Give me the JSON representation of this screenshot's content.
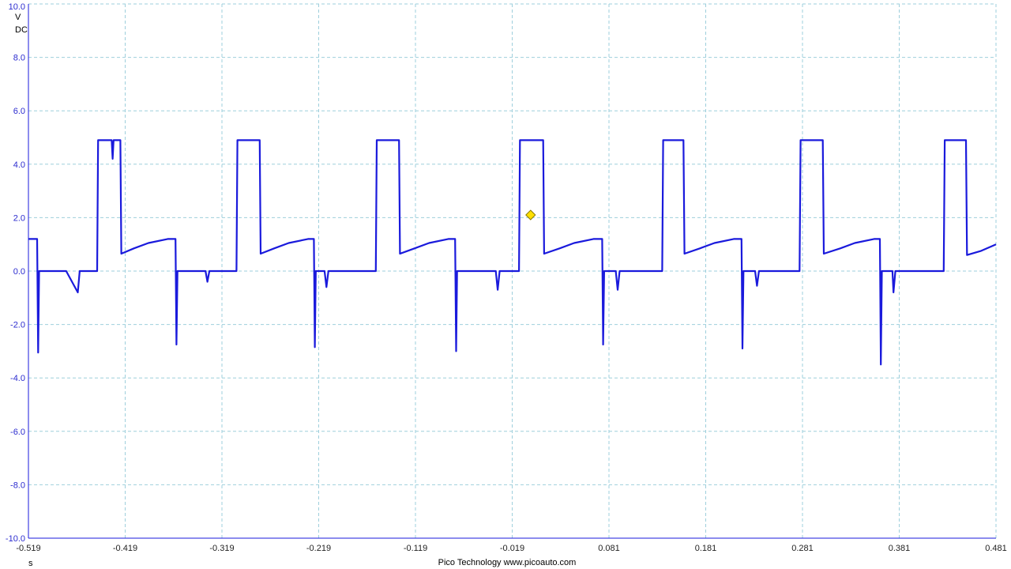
{
  "chart_data": {
    "type": "line",
    "title": "",
    "xlabel": "",
    "ylabel": "",
    "x_unit": "s",
    "y_unit": "V",
    "coupling": "DC",
    "xlim": [
      -0.519,
      0.481
    ],
    "ylim": [
      -10.0,
      10.0
    ],
    "grid": true,
    "grid_style": "dashed",
    "x_ticks": [
      "-0.519",
      "-0.419",
      "-0.319",
      "-0.219",
      "-0.119",
      "-0.019",
      "0.081",
      "0.181",
      "0.281",
      "0.381",
      "0.481"
    ],
    "y_ticks": [
      "10.0",
      "8.0",
      "6.0",
      "4.0",
      "2.0",
      "0.0",
      "-2.0",
      "-4.0",
      "-6.0",
      "-8.0",
      "-10.0"
    ],
    "colors": {
      "trace": "#1a1adc",
      "axis_text": "#2c2ccf",
      "grid": "#9ecfdc",
      "trigger": "#ffe000"
    },
    "trigger": {
      "x": 0.0,
      "y": 2.1
    },
    "series": [
      {
        "points": [
          [
            -0.519,
            1.2
          ],
          [
            -0.51,
            1.2
          ],
          [
            -0.509,
            -3.05
          ],
          [
            -0.508,
            0.0
          ],
          [
            -0.48,
            0.0
          ],
          [
            -0.468,
            -0.8
          ],
          [
            -0.466,
            0.0
          ],
          [
            -0.448,
            0.0
          ],
          [
            -0.447,
            4.9
          ],
          [
            -0.433,
            4.9
          ],
          [
            -0.432,
            4.2
          ],
          [
            -0.431,
            4.9
          ],
          [
            -0.424,
            4.9
          ],
          [
            -0.423,
            0.65
          ],
          [
            -0.41,
            0.85
          ],
          [
            -0.395,
            1.05
          ],
          [
            -0.375,
            1.2
          ],
          [
            -0.367,
            1.2
          ],
          [
            -0.366,
            -2.75
          ],
          [
            -0.365,
            0.0
          ],
          [
            -0.336,
            0.0
          ],
          [
            -0.334,
            -0.4
          ],
          [
            -0.332,
            0.0
          ],
          [
            -0.304,
            0.0
          ],
          [
            -0.303,
            4.9
          ],
          [
            -0.28,
            4.9
          ],
          [
            -0.279,
            0.65
          ],
          [
            -0.265,
            0.85
          ],
          [
            -0.25,
            1.05
          ],
          [
            -0.23,
            1.2
          ],
          [
            -0.224,
            1.2
          ],
          [
            -0.223,
            -2.85
          ],
          [
            -0.222,
            0.0
          ],
          [
            -0.213,
            0.0
          ],
          [
            -0.211,
            -0.6
          ],
          [
            -0.209,
            0.0
          ],
          [
            -0.16,
            0.0
          ],
          [
            -0.159,
            4.9
          ],
          [
            -0.136,
            4.9
          ],
          [
            -0.135,
            0.65
          ],
          [
            -0.12,
            0.85
          ],
          [
            -0.105,
            1.05
          ],
          [
            -0.085,
            1.2
          ],
          [
            -0.078,
            1.2
          ],
          [
            -0.077,
            -3.0
          ],
          [
            -0.076,
            0.0
          ],
          [
            -0.036,
            0.0
          ],
          [
            -0.034,
            -0.7
          ],
          [
            -0.032,
            0.0
          ],
          [
            -0.012,
            0.0
          ],
          [
            -0.011,
            4.9
          ],
          [
            0.013,
            4.9
          ],
          [
            0.014,
            0.65
          ],
          [
            0.03,
            0.85
          ],
          [
            0.045,
            1.05
          ],
          [
            0.065,
            1.2
          ],
          [
            0.074,
            1.2
          ],
          [
            0.075,
            -2.75
          ],
          [
            0.076,
            0.0
          ],
          [
            0.088,
            0.0
          ],
          [
            0.09,
            -0.7
          ],
          [
            0.092,
            0.0
          ],
          [
            0.136,
            0.0
          ],
          [
            0.137,
            4.9
          ],
          [
            0.158,
            4.9
          ],
          [
            0.159,
            0.65
          ],
          [
            0.175,
            0.85
          ],
          [
            0.19,
            1.05
          ],
          [
            0.21,
            1.2
          ],
          [
            0.218,
            1.2
          ],
          [
            0.219,
            -2.9
          ],
          [
            0.22,
            0.0
          ],
          [
            0.232,
            0.0
          ],
          [
            0.234,
            -0.55
          ],
          [
            0.236,
            0.0
          ],
          [
            0.278,
            0.0
          ],
          [
            0.279,
            4.9
          ],
          [
            0.302,
            4.9
          ],
          [
            0.303,
            0.65
          ],
          [
            0.32,
            0.85
          ],
          [
            0.335,
            1.05
          ],
          [
            0.355,
            1.2
          ],
          [
            0.361,
            1.2
          ],
          [
            0.362,
            -3.5
          ],
          [
            0.363,
            0.0
          ],
          [
            0.374,
            0.0
          ],
          [
            0.375,
            -0.8
          ],
          [
            0.377,
            0.0
          ],
          [
            0.427,
            0.0
          ],
          [
            0.428,
            4.9
          ],
          [
            0.45,
            4.9
          ],
          [
            0.451,
            0.6
          ],
          [
            0.465,
            0.75
          ],
          [
            0.481,
            1.0
          ]
        ]
      }
    ]
  },
  "footer": {
    "brand": "Pico Technology  www.picoauto.com"
  }
}
